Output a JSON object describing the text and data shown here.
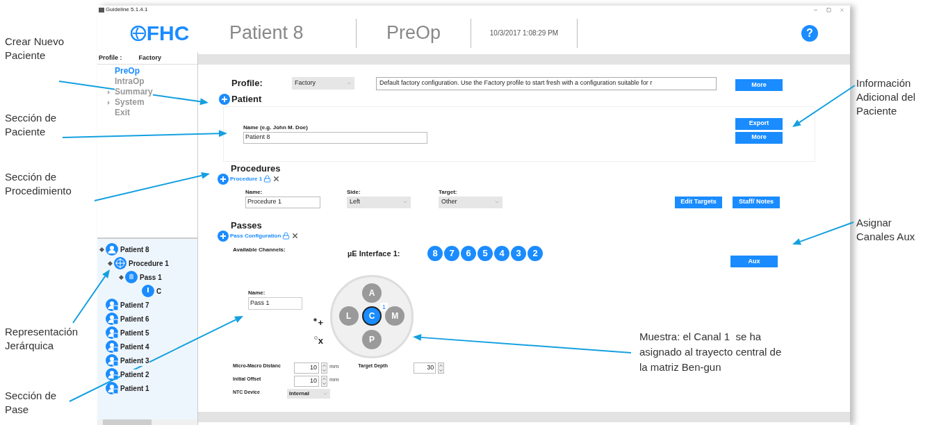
{
  "callouts_left": [
    {
      "text": "Crear Nuevo Paciente"
    },
    {
      "text": "Sección de Paciente"
    },
    {
      "text": "Sección de Procedimiento"
    },
    {
      "text": "Representación Jerárquica"
    },
    {
      "text": "Sección de Pase"
    }
  ],
  "callouts_right": [
    {
      "text": "Información Adicional del Paciente"
    },
    {
      "text": "Asignar Canales Aux"
    },
    {
      "text": "Muestra: el Canal 1  se ha asignado al trayecto central de la matriz Ben-gun"
    }
  ],
  "window": {
    "title": "Guideline 5.1.4.1"
  },
  "header": {
    "logo": "FHC",
    "patient": "Patient 8",
    "phase": "PreOp",
    "datetime": "10/3/2017 1:08:29 PM",
    "help": "?"
  },
  "sidebar": {
    "profile_label": "Profile :",
    "profile_value": "Factory",
    "nav": [
      {
        "label": "PreOp",
        "selected": true,
        "expandable": false
      },
      {
        "label": "IntraOp",
        "selected": false,
        "expandable": false
      },
      {
        "label": "Summary",
        "selected": false,
        "expandable": true
      },
      {
        "label": "System",
        "selected": false,
        "expandable": true
      },
      {
        "label": "Exit",
        "selected": false,
        "expandable": false
      }
    ],
    "tree": [
      {
        "kind": "patient",
        "label": "Patient 8",
        "locked": false,
        "expanded": true,
        "children": [
          {
            "kind": "procedure",
            "label": "Procedure 1",
            "expanded": true,
            "children": [
              {
                "kind": "pass",
                "label": "Pass 1",
                "expanded": true,
                "children": [
                  {
                    "kind": "channel",
                    "label": "C"
                  }
                ]
              }
            ]
          }
        ]
      },
      {
        "kind": "patient",
        "label": "Patient 7",
        "locked": true
      },
      {
        "kind": "patient",
        "label": "Patient 6",
        "locked": true
      },
      {
        "kind": "patient",
        "label": "Patient 5",
        "locked": true
      },
      {
        "kind": "patient",
        "label": "Patient 4",
        "locked": true
      },
      {
        "kind": "patient",
        "label": "Patient 3",
        "locked": true
      },
      {
        "kind": "patient",
        "label": "Patient 2",
        "locked": true
      },
      {
        "kind": "patient",
        "label": "Patient 1",
        "locked": true
      }
    ]
  },
  "profile": {
    "label": "Profile:",
    "value": "Factory",
    "description": "Default factory configuration. Use the Factory profile to start fresh with a configuration suitable for r",
    "button": "More"
  },
  "patient": {
    "title": "Patient",
    "name_label": "Name (e.g. John M. Doe)",
    "name_value": "Patient 8",
    "buttons": [
      "Export",
      "More"
    ]
  },
  "procedures": {
    "title": "Procedures",
    "tab": "Procedure 1",
    "fields": [
      {
        "label": "Name:",
        "value": "Procedure 1",
        "kind": "text"
      },
      {
        "label": "Side:",
        "value": "Left",
        "kind": "select"
      },
      {
        "label": "Target:",
        "value": "Other",
        "kind": "select"
      }
    ],
    "buttons": [
      "Edit Targets",
      "Staff/ Notes"
    ]
  },
  "passes": {
    "title": "Passes",
    "tab": "Pass Configuration",
    "available_label": "Available Channels:",
    "interface_label": "µE Interface 1:",
    "channels": [
      "8",
      "7",
      "6",
      "5",
      "4",
      "3",
      "2"
    ],
    "aux_button": "Aux",
    "name_label": "Name:",
    "name_value": "Pass 1",
    "electrodes": [
      {
        "label": "A",
        "selected": false
      },
      {
        "label": "L",
        "selected": false
      },
      {
        "label": "C",
        "selected": true,
        "badge": "1"
      },
      {
        "label": "M",
        "selected": false
      },
      {
        "label": "P",
        "selected": false
      }
    ],
    "orientation": [
      {
        "label": "+",
        "selected": true
      },
      {
        "label": "x",
        "selected": false
      }
    ],
    "micro_macro": {
      "label": "Micro-Macro Distanc",
      "value": "10",
      "unit": "mm"
    },
    "initial_offset": {
      "label": "Initial Offset",
      "value": "10",
      "unit": "mm"
    },
    "target_depth": {
      "label": "Target Depth",
      "value": "30"
    },
    "ntc": {
      "label": "NTC Device",
      "value": "Internal"
    }
  }
}
